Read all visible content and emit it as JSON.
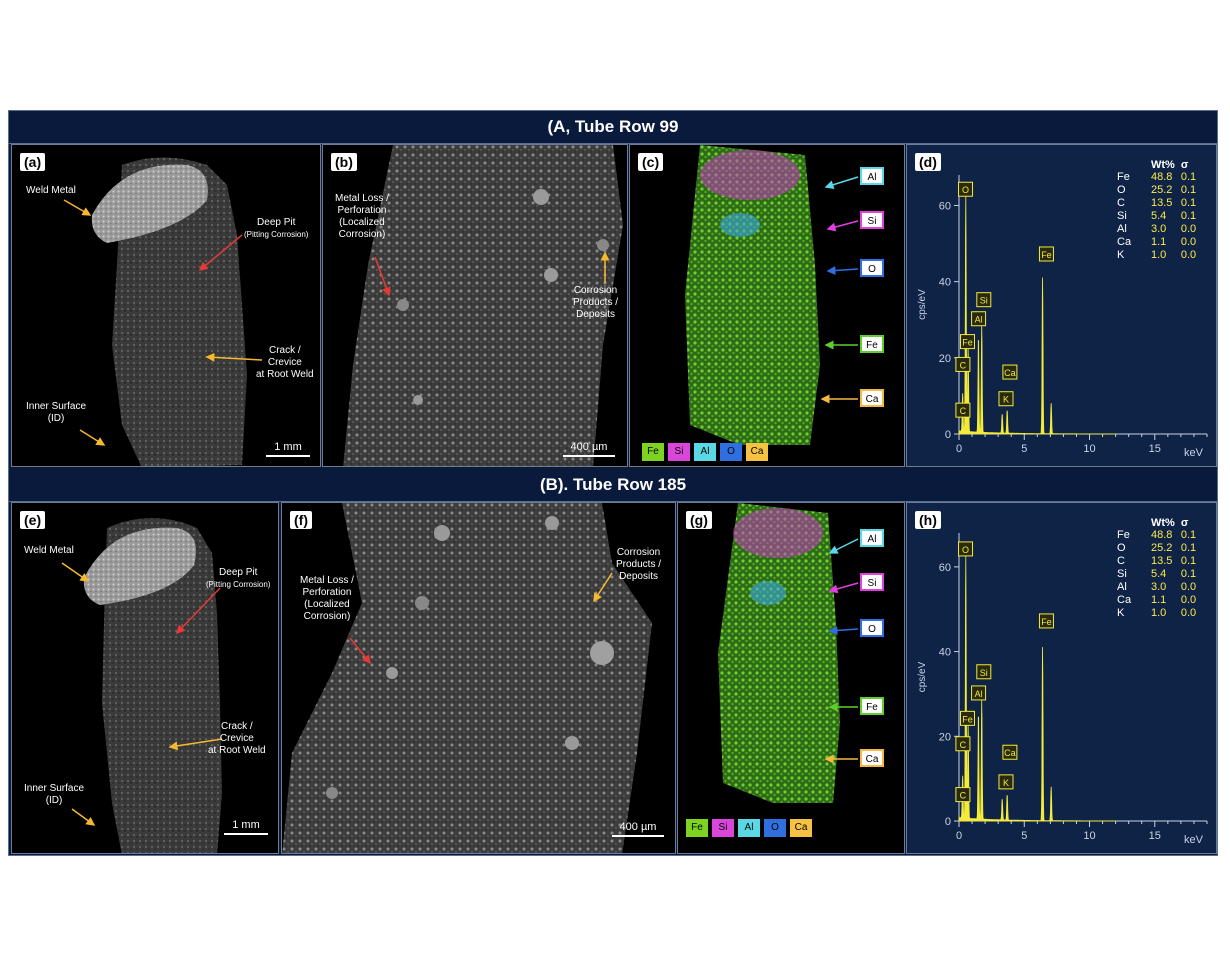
{
  "rows": [
    {
      "header": "(A, Tube Row 99",
      "panels": {
        "sem_low": {
          "letter": "(a)",
          "weld_metal": "Weld Metal",
          "deep_pit": "Deep Pit",
          "deep_pit_sub": "(Pitting Corrosion)",
          "crack": "Crack /\nCrevice\nat Root Weld",
          "inner_surface": "Inner Surface\n(ID)",
          "scale": "1 mm"
        },
        "sem_high": {
          "letter": "(b)",
          "metal_loss": "Metal Loss /\nPerforation\n(Localized\nCorrosion)",
          "corrosion_products": "Corrosion\nProducts /\nDeposits",
          "scale": "400 µm"
        },
        "map": {
          "letter": "(c)"
        },
        "eds": {
          "letter": "(d)"
        }
      }
    },
    {
      "header": "(B). Tube Row 185",
      "panels": {
        "sem_low": {
          "letter": "(e)",
          "weld_metal": "Weld Metal",
          "deep_pit": "Deep Pit",
          "deep_pit_sub": "(Pitting Corrosion)",
          "crack": "Crack /\nCrevice\nat Root Weld",
          "inner_surface": "Inner Surface\n(ID)",
          "scale": "1 mm"
        },
        "sem_high": {
          "letter": "(f)",
          "metal_loss": "Metal Loss /\nPerforation\n(Localized\nCorrosion)",
          "corrosion_products": "Corrosion\nProducts /\nDeposits",
          "scale": "400 µm"
        },
        "map": {
          "letter": "(g)"
        },
        "eds": {
          "letter": "(h)"
        }
      }
    }
  ],
  "map_labels": [
    "Al",
    "Si",
    "O",
    "Fe",
    "Ca"
  ],
  "legend": [
    {
      "el": "Fe",
      "color": "#7ed321"
    },
    {
      "el": "Si",
      "color": "#d946d9"
    },
    {
      "el": "Al",
      "color": "#5ad8e6"
    },
    {
      "el": "O",
      "color": "#2f6fe0"
    },
    {
      "el": "Ca",
      "color": "#f5c242"
    }
  ],
  "element_colors": {
    "Al": "#5ad8e6",
    "Si": "#e040e0",
    "O": "#2f6fe0",
    "Fe": "#5fcf2a",
    "Ca": "#f5b942"
  },
  "eds_axes": {
    "ylabel": "cps/eV",
    "xunit": "keV",
    "yticks": [
      "0",
      "20",
      "40",
      "60"
    ],
    "xticks": [
      "0",
      "5",
      "10",
      "15"
    ]
  },
  "wt_table": {
    "header": [
      "",
      "Wt%",
      "σ"
    ],
    "rows": [
      [
        "Fe",
        "48.8",
        "0.1"
      ],
      [
        "O",
        "25.2",
        "0.1"
      ],
      [
        "C",
        "13.5",
        "0.1"
      ],
      [
        "Si",
        "5.4",
        "0.1"
      ],
      [
        "Al",
        "3.0",
        "0.0"
      ],
      [
        "Ca",
        "1.1",
        "0.0"
      ],
      [
        "K",
        "1.0",
        "0.0"
      ]
    ]
  },
  "chart_data": [
    {
      "type": "line",
      "title": "",
      "xlabel": "keV",
      "ylabel": "cps/eV",
      "xlim": [
        0,
        19
      ],
      "ylim": [
        0,
        68
      ],
      "peaks": [
        {
          "label": "C",
          "x": 0.28,
          "y": 10
        },
        {
          "label": "O",
          "x": 0.52,
          "y": 62
        },
        {
          "label": "Fe",
          "x": 0.7,
          "y": 22
        },
        {
          "label": "Al",
          "x": 1.49,
          "y": 25
        },
        {
          "label": "Si",
          "x": 1.74,
          "y": 28
        },
        {
          "label": "K",
          "x": 3.31,
          "y": 5
        },
        {
          "label": "Ca",
          "x": 3.69,
          "y": 6
        },
        {
          "label": "Fe",
          "x": 6.4,
          "y": 41
        },
        {
          "label": "Fe",
          "x": 7.06,
          "y": 8
        }
      ],
      "peak_labels": [
        {
          "label": "O",
          "x": 0.5,
          "y": 64
        },
        {
          "label": "Si",
          "x": 1.9,
          "y": 35
        },
        {
          "label": "Al",
          "x": 1.5,
          "y": 30
        },
        {
          "label": "Fe",
          "x": 0.65,
          "y": 24
        },
        {
          "label": "C",
          "x": 0.3,
          "y": 18
        },
        {
          "label": "Ca",
          "x": 3.9,
          "y": 16
        },
        {
          "label": "K",
          "x": 3.6,
          "y": 9
        },
        {
          "label": "C",
          "x": 0.3,
          "y": 6
        },
        {
          "label": "Fe",
          "x": 6.7,
          "y": 47
        }
      ]
    },
    {
      "type": "line",
      "title": "",
      "xlabel": "keV",
      "ylabel": "cps/eV",
      "xlim": [
        0,
        19
      ],
      "ylim": [
        0,
        68
      ],
      "peaks": [
        {
          "label": "C",
          "x": 0.28,
          "y": 10
        },
        {
          "label": "O",
          "x": 0.52,
          "y": 62
        },
        {
          "label": "Fe",
          "x": 0.7,
          "y": 22
        },
        {
          "label": "Al",
          "x": 1.49,
          "y": 25
        },
        {
          "label": "Si",
          "x": 1.74,
          "y": 28
        },
        {
          "label": "K",
          "x": 3.31,
          "y": 5
        },
        {
          "label": "Ca",
          "x": 3.69,
          "y": 6
        },
        {
          "label": "Fe",
          "x": 6.4,
          "y": 41
        },
        {
          "label": "Fe",
          "x": 7.06,
          "y": 8
        }
      ],
      "peak_labels": [
        {
          "label": "O",
          "x": 0.5,
          "y": 64
        },
        {
          "label": "Si",
          "x": 1.9,
          "y": 35
        },
        {
          "label": "Al",
          "x": 1.5,
          "y": 30
        },
        {
          "label": "Fe",
          "x": 0.65,
          "y": 24
        },
        {
          "label": "C",
          "x": 0.3,
          "y": 18
        },
        {
          "label": "Ca",
          "x": 3.9,
          "y": 16
        },
        {
          "label": "K",
          "x": 3.6,
          "y": 9
        },
        {
          "label": "C",
          "x": 0.3,
          "y": 6
        },
        {
          "label": "Fe",
          "x": 6.7,
          "y": 47
        }
      ]
    }
  ]
}
